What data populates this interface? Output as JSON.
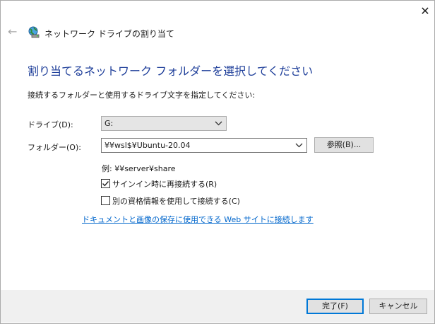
{
  "window": {
    "title": "ネットワーク ドライブの割り当て",
    "close_glyph": "✕",
    "back_glyph": "←"
  },
  "heading": "割り当てるネットワーク フォルダーを選択してください",
  "instruction": "接続するフォルダーと使用するドライブ文字を指定してください:",
  "drive": {
    "label": "ドライブ(D):",
    "value": "G:"
  },
  "folder": {
    "label": "フォルダー(O):",
    "value": "¥¥wsl$¥Ubuntu-20.04",
    "browse_label": "参照(B)..."
  },
  "example": "例: ¥¥server¥share",
  "reconnect": {
    "label": "サインイン時に再接続する(R)",
    "checked": true
  },
  "other_credentials": {
    "label": "別の資格情報を使用して接続する(C)",
    "checked": false
  },
  "link": "ドキュメントと画像の保存に使用できる Web サイトに接続します",
  "footer": {
    "finish_label": "完了(F)",
    "cancel_label": "キャンセル"
  },
  "colors": {
    "heading": "#1f3f9a",
    "link": "#0066cc",
    "accent": "#0078d7",
    "footer_bg": "#f0f0f0"
  }
}
